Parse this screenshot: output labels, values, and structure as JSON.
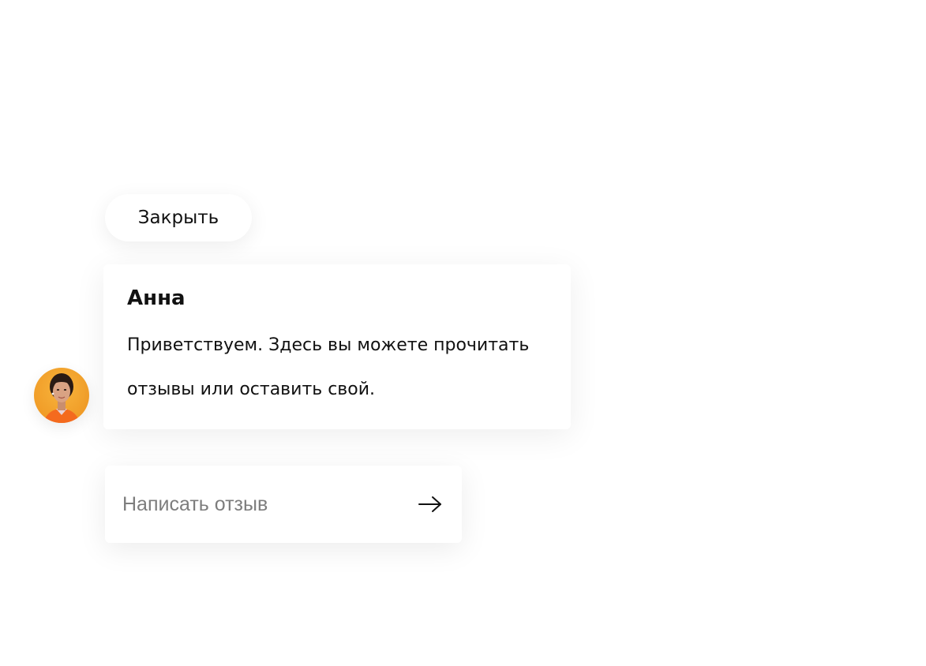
{
  "close_button": {
    "label": "Закрыть"
  },
  "message": {
    "author": "Анна",
    "text": "Приветствуем. Здесь вы можете прочитать отзывы или оставить свой."
  },
  "avatar": {
    "icon": "operator-avatar-photo",
    "background_color": "#f3a12c",
    "shirt_color": "#f46a1e"
  },
  "review_input": {
    "value": "",
    "placeholder": "Написать отзыв"
  },
  "send_button": {
    "icon": "arrow-right-icon"
  }
}
